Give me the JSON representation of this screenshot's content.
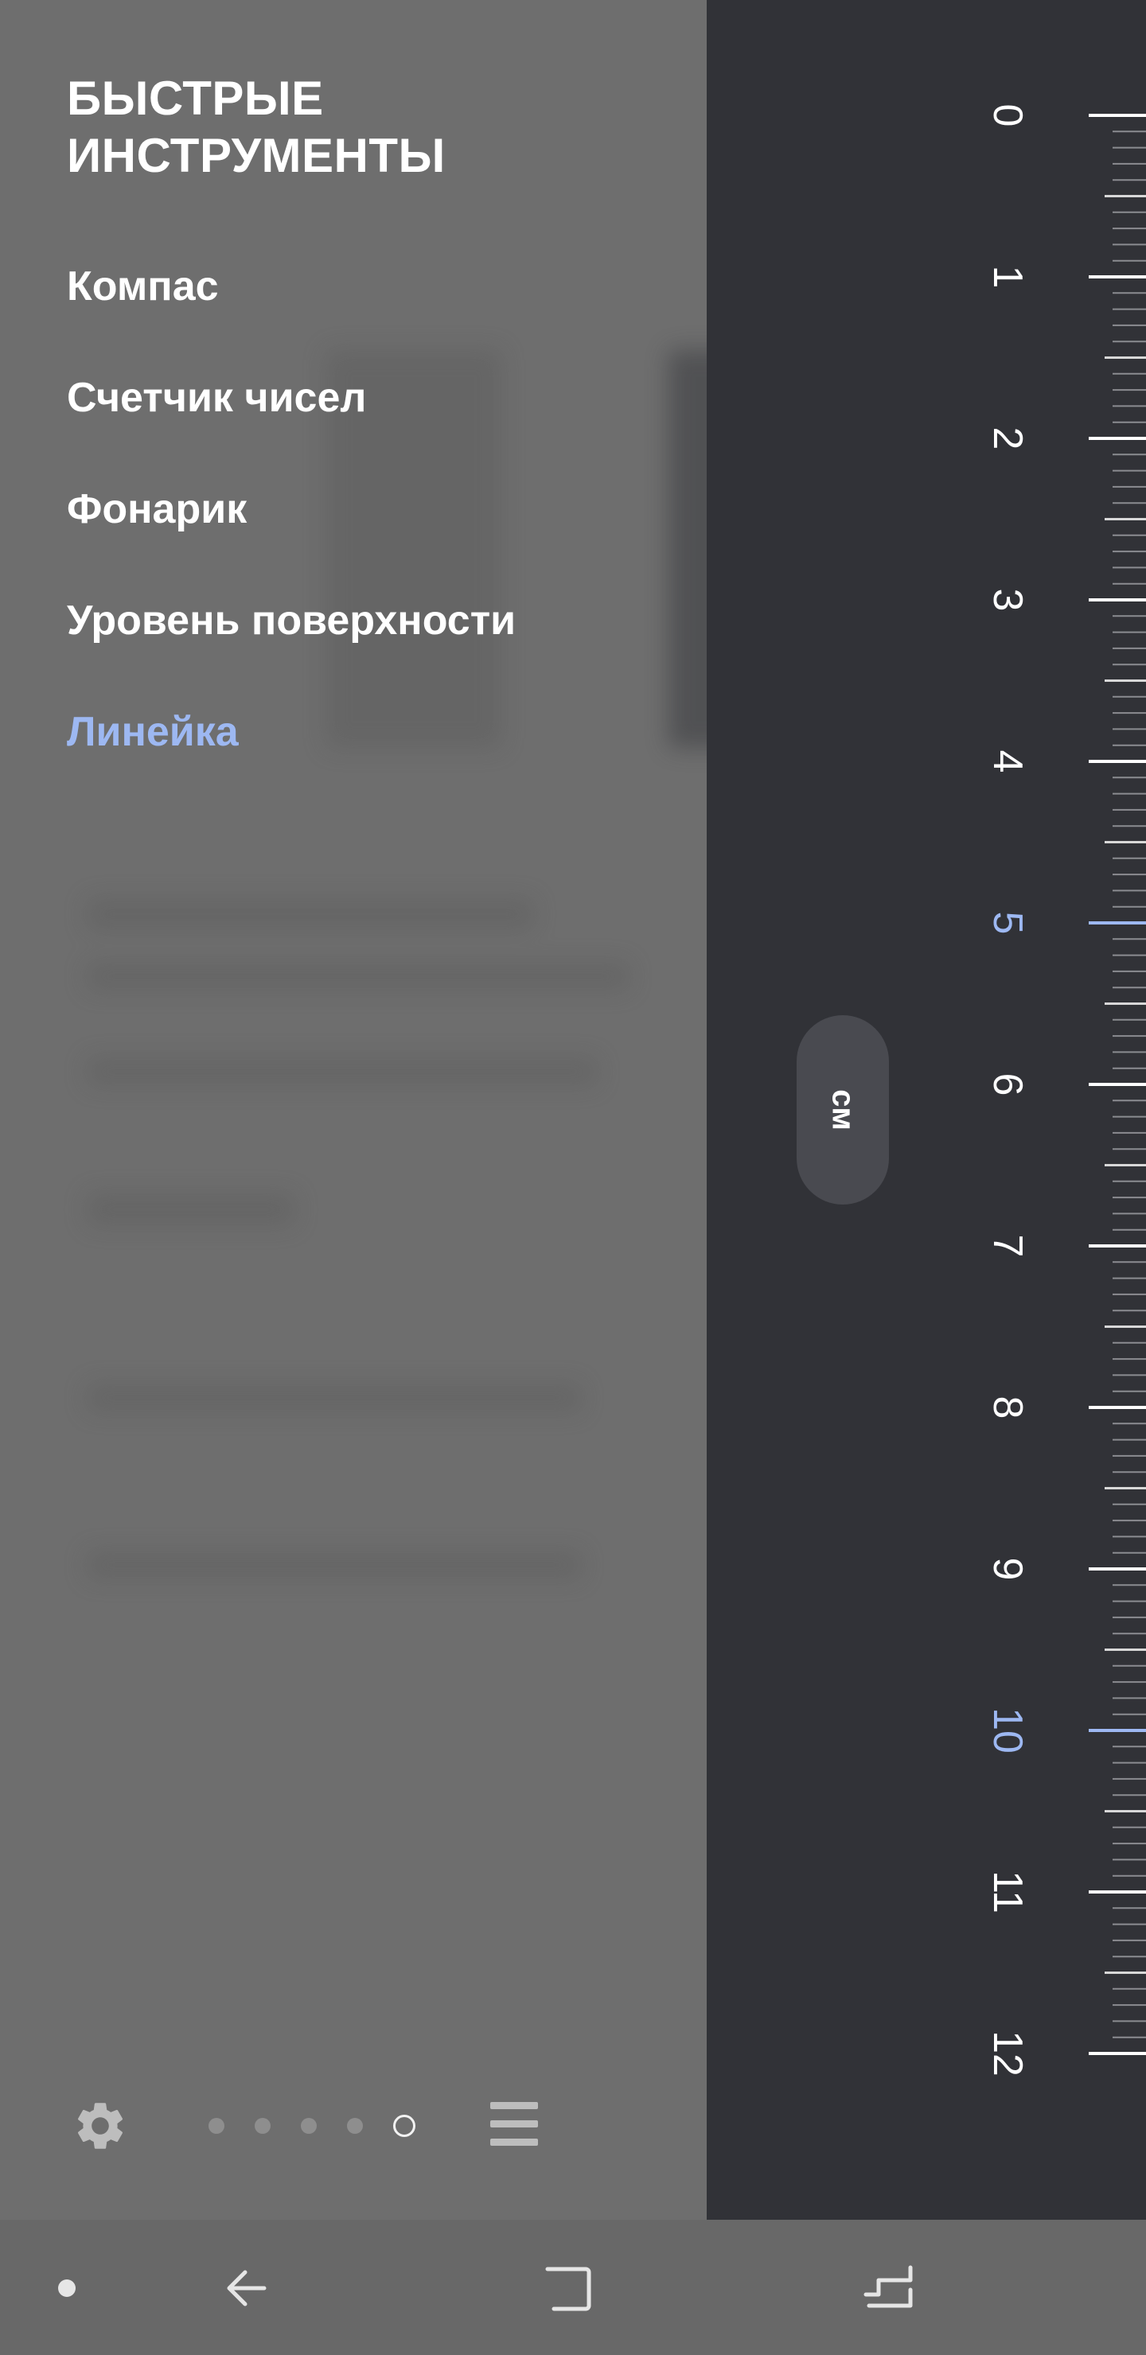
{
  "menu": {
    "title": "БЫСТРЫЕ ИНСТРУМЕНТЫ",
    "items": [
      {
        "label": "Компас",
        "active": false
      },
      {
        "label": "Счетчик чисел",
        "active": false
      },
      {
        "label": "Фонарик",
        "active": false
      },
      {
        "label": "Уровень поверхности",
        "active": false
      },
      {
        "label": "Линейка",
        "active": true
      }
    ]
  },
  "pager": {
    "total_pages": 5,
    "current_page": 5
  },
  "icons": {
    "settings": "gear-icon",
    "list": "list-icon",
    "nav_dot": "dot-icon",
    "nav_back": "back-icon",
    "nav_home": "home-icon",
    "nav_recents": "recents-icon"
  },
  "ruler": {
    "unit": "см",
    "labels": [
      "0",
      "1",
      "2",
      "3",
      "4",
      "5",
      "6",
      "7",
      "8",
      "9",
      "10",
      "11",
      "12"
    ],
    "highlighted": [
      "5",
      "10"
    ]
  },
  "colors": {
    "accent": "#9db8f2",
    "ruler_bg": "#313237",
    "panel_bg": "#6e6e6e",
    "nav_bg": "#686868"
  }
}
